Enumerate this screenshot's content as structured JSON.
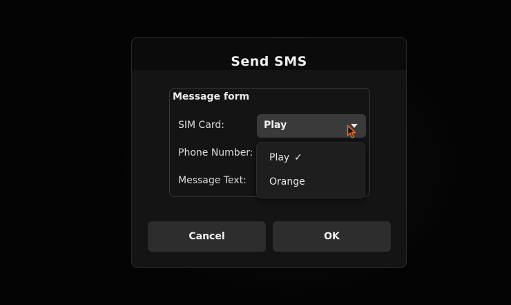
{
  "dialog": {
    "title": "Send SMS",
    "group_title": "Message form",
    "fields": {
      "sim_card_label": "SIM Card:",
      "phone_number_label": "Phone Number:",
      "message_text_label": "Message Text:"
    },
    "sim_combo": {
      "selected": "Play",
      "options": [
        {
          "label": "Play",
          "checked": true
        },
        {
          "label": "Orange",
          "checked": false
        }
      ]
    },
    "buttons": {
      "cancel": "Cancel",
      "ok": "OK"
    }
  },
  "icons": {
    "check": "check-icon",
    "dropdown": "chevron-down-icon",
    "cursor": "mouse-pointer-icon"
  },
  "colors": {
    "cursor": "#e07020",
    "dialog_bg": "#141414",
    "button_bg": "#2d2d2d"
  }
}
